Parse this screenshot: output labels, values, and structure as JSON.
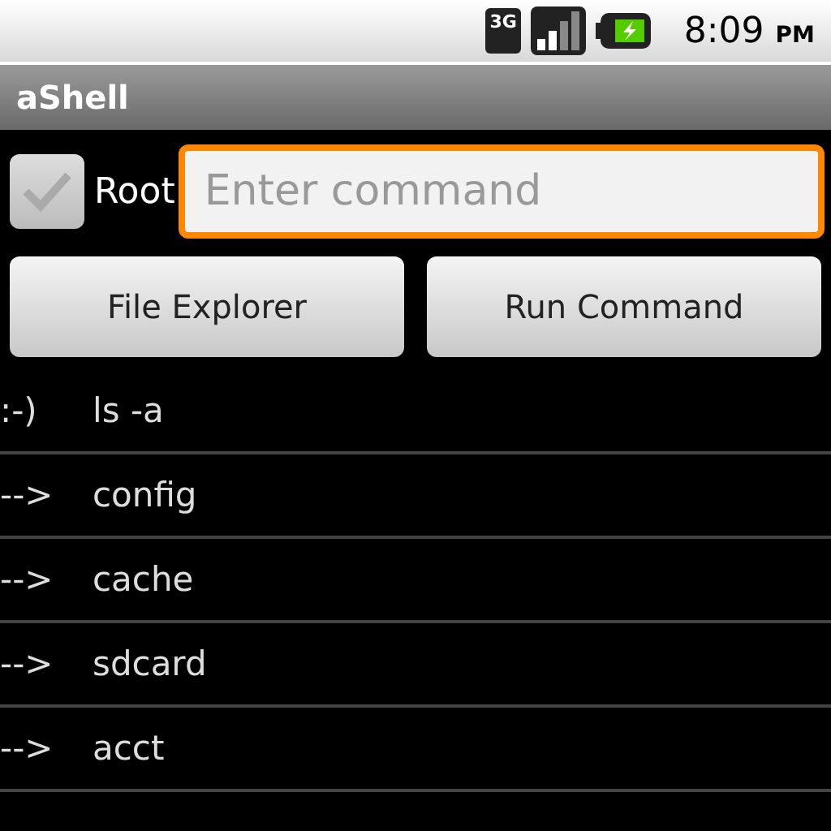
{
  "status_bar": {
    "network": "3G",
    "time": "8:09",
    "ampm": "PM"
  },
  "window": {
    "title": "aShell"
  },
  "root_checkbox": {
    "label": "Root",
    "checked": true
  },
  "command_field": {
    "placeholder": "Enter command",
    "focused": true
  },
  "buttons": [
    "File Explorer",
    "Run Command"
  ],
  "output": [
    {
      "prefix": ":-)",
      "text": "ls -a"
    },
    {
      "prefix": "-->",
      "text": "config"
    },
    {
      "prefix": "-->",
      "text": "cache"
    },
    {
      "prefix": "-->",
      "text": "sdcard"
    },
    {
      "prefix": "-->",
      "text": "acct"
    }
  ]
}
